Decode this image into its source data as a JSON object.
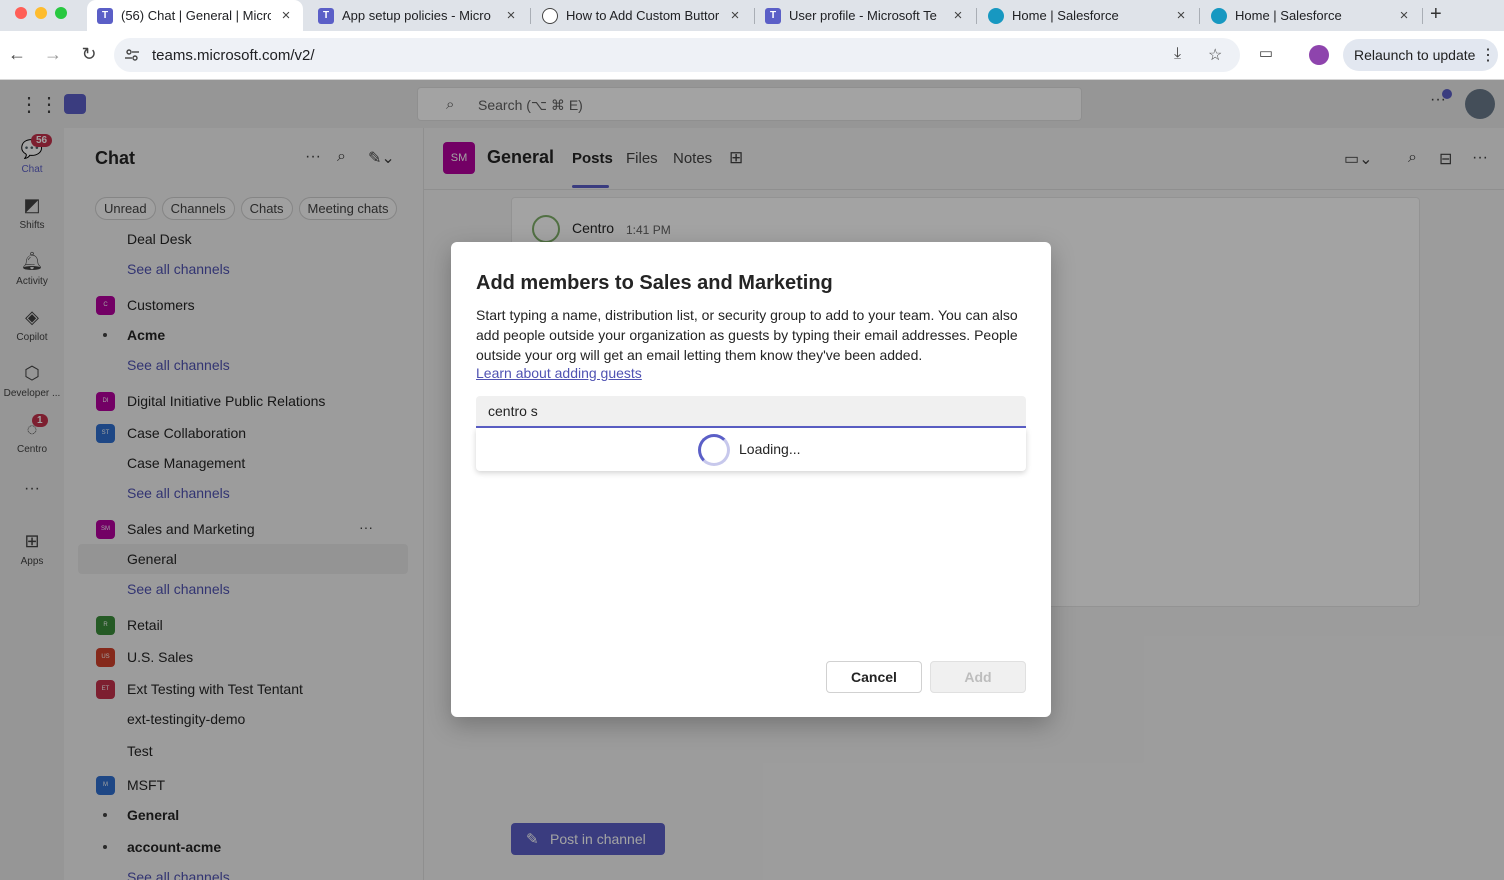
{
  "browser": {
    "tabs": [
      {
        "label": "(56) Chat | General | Micro",
        "icon": "teams-icon",
        "color": "#5b5fc7",
        "active": true
      },
      {
        "label": "App setup policies - Micro",
        "icon": "teams-icon",
        "color": "#5b5fc7"
      },
      {
        "label": "How to Add Custom Buttor",
        "icon": "globe-icon",
        "color": "#444444"
      },
      {
        "label": "User profile - Microsoft Te",
        "icon": "teams-icon",
        "color": "#5b5fc7"
      },
      {
        "label": "Home | Salesforce",
        "icon": "salesforce-icon",
        "color": "#1798c1"
      },
      {
        "label": "Home | Salesforce",
        "icon": "salesforce-icon",
        "color": "#1798c1"
      }
    ],
    "new_tab": "+",
    "close_glyph": "×",
    "url": "teams.microsoft.com/v2/",
    "relaunch_label": "Relaunch to update"
  },
  "teams": {
    "search_placeholder": "Search (⌥ ⌘ E)"
  },
  "rail": {
    "items": [
      {
        "label": "Chat",
        "icon": "chat-icon",
        "badge": "56"
      },
      {
        "label": "Shifts",
        "icon": "shifts-icon"
      },
      {
        "label": "Activity",
        "icon": "bell-icon"
      },
      {
        "label": "Copilot",
        "icon": "copilot-icon"
      },
      {
        "label": "Developer ...",
        "icon": "developer-icon"
      },
      {
        "label": "Centro",
        "icon": "centro-icon",
        "badge": "1"
      },
      {
        "label": "Apps",
        "icon": "plus-square-icon"
      }
    ],
    "more": "···"
  },
  "chatpanel": {
    "title": "Chat",
    "filters": [
      "Unread",
      "Channels",
      "Chats",
      "Meeting chats"
    ],
    "rows": [
      {
        "label": "Deal Desk",
        "kind": "channel"
      },
      {
        "label": "See all channels",
        "kind": "link"
      },
      {
        "label": "Customers",
        "kind": "team",
        "abbr": "C",
        "color": "#b4009e"
      },
      {
        "label": "Acme",
        "kind": "bold"
      },
      {
        "label": "See all channels",
        "kind": "link"
      },
      {
        "label": "Digital Initiative Public Relations",
        "kind": "team",
        "abbr": "DI",
        "color": "#b4009e"
      },
      {
        "label": "Case Collaboration",
        "kind": "team",
        "abbr": "ST",
        "color": "#2f6fd0"
      },
      {
        "label": "Case Management",
        "kind": "channel"
      },
      {
        "label": "See all channels",
        "kind": "link"
      },
      {
        "label": "Sales and Marketing",
        "kind": "team",
        "abbr": "SM",
        "color": "#b4009e"
      },
      {
        "label": "General",
        "kind": "selected"
      },
      {
        "label": "See all channels",
        "kind": "link"
      },
      {
        "label": "Retail",
        "kind": "team",
        "abbr": "R",
        "color": "#3a8d3a"
      },
      {
        "label": "U.S. Sales",
        "kind": "team",
        "abbr": "US",
        "color": "#d1402b"
      },
      {
        "label": "Ext Testing with Test Tentant",
        "kind": "team",
        "abbr": "ET",
        "color": "#c4314b"
      },
      {
        "label": "ext-testingity-demo",
        "kind": "channel"
      },
      {
        "label": "Test",
        "kind": "channel"
      },
      {
        "label": "MSFT",
        "kind": "team",
        "abbr": "M",
        "color": "#2f6fd0"
      },
      {
        "label": "General",
        "kind": "bold"
      },
      {
        "label": "account-acme",
        "kind": "bold"
      },
      {
        "label": "See all channels",
        "kind": "link"
      }
    ]
  },
  "channel": {
    "avatar": "SM",
    "name": "General",
    "tabs": [
      "Posts",
      "Files",
      "Notes"
    ],
    "post_author": "Centro",
    "post_time": "1:41 PM",
    "post_button": "Post in channel"
  },
  "dialog": {
    "title": "Add members to Sales and Marketing",
    "description": "Start typing a name, distribution list, or security group to add to your team. You can also add people outside your organization as guests by typing their email addresses. People outside your org will get an email letting them know they've been added.",
    "link": "Learn about adding guests",
    "input_value": "centro s",
    "loading": "Loading...",
    "cancel": "Cancel",
    "add": "Add"
  },
  "colors": {
    "accent": "#5b5fc7",
    "badge": "#c4314b"
  }
}
